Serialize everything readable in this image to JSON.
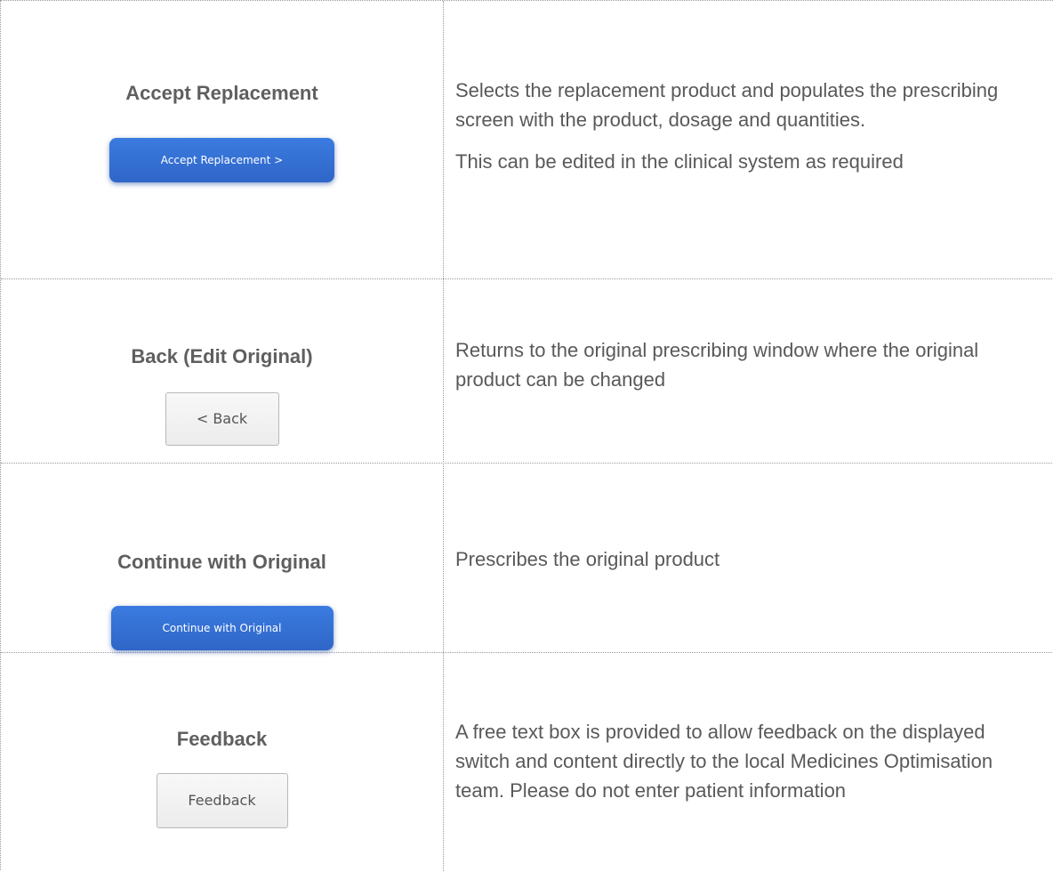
{
  "rows": [
    {
      "heading": "Accept Replacement",
      "button": "Accept Replacement >",
      "description": [
        "Selects the replacement product and populates the prescribing screen with the product, dosage and quantities.",
        "This can be edited in the clinical system as required"
      ]
    },
    {
      "heading": "Back (Edit Original)",
      "button": "< Back",
      "description": [
        "Returns to the original prescribing window where the original product can be changed"
      ]
    },
    {
      "heading": "Continue with Original",
      "button": "Continue with Original",
      "description": [
        "Prescribes the original product"
      ]
    },
    {
      "heading": "Feedback",
      "button": "Feedback",
      "description": [
        "A free text box is provided to allow feedback on the displayed switch and content directly to the local Medicines Optimisation team. Please do not enter patient information"
      ]
    }
  ],
  "colors": {
    "primary_button": "#2f6fd6",
    "text": "#595959",
    "border": "#9a9a9a"
  }
}
